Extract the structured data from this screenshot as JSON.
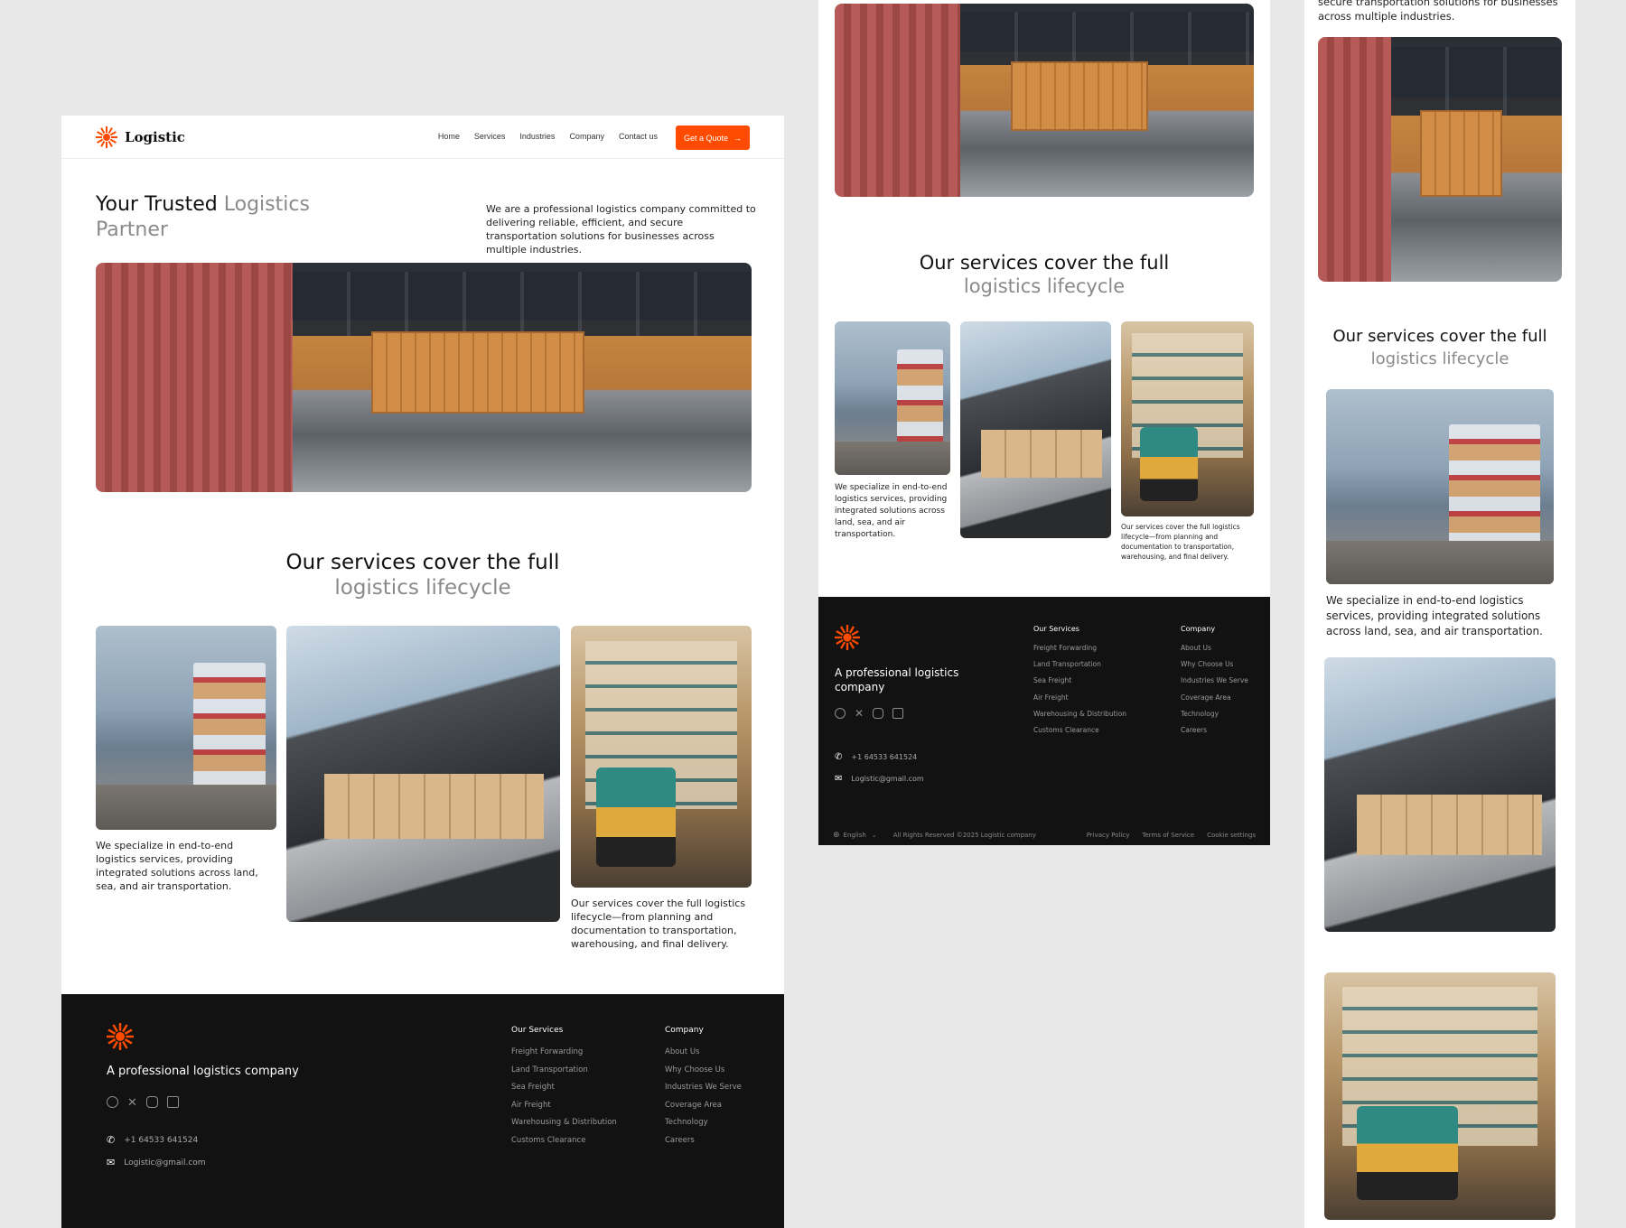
{
  "brand": {
    "name": "Logistic",
    "accent": "#ff4b00"
  },
  "nav": {
    "links": [
      "Home",
      "Services",
      "Industries",
      "Company",
      "Contact us"
    ],
    "cta": "Get a Quote",
    "cta_icon": "arrow-right-icon"
  },
  "hero": {
    "title_dark": "Your Trusted",
    "title_muted_1": "Logistics",
    "title_muted_2": "Partner",
    "description": "We are a professional logistics company committed to delivering reliable, efficient, and secure transportation solutions for businesses across multiple industries.",
    "description_partial": "secure transportation solutions for businesses across multiple industries."
  },
  "services": {
    "title_dark": "Our services cover the full",
    "title_muted": "logistics lifecycle",
    "caption_1": "We specialize in end-to-end logistics services, providing integrated solutions across land, sea, and air transportation.",
    "caption_2": "Our services cover the full logistics lifecycle—from planning and documentation to transportation, warehousing, and final delivery."
  },
  "footer": {
    "tagline": "A professional logistics company",
    "social_icons": [
      "facebook-icon",
      "x-icon",
      "instagram-icon",
      "linkedin-icon"
    ],
    "phone": "+1 64533 641524",
    "email": "Logistic@gmail.com",
    "services_heading": "Our Services",
    "services": [
      "Freight Forwarding",
      "Land Transportation",
      "Sea Freight",
      "Air Freight",
      "Warehousing & Distribution",
      "Customs Clearance"
    ],
    "company_heading": "Company",
    "company": [
      "About Us",
      "Why Choose Us",
      "Industries We Serve",
      "Coverage Area",
      "Technology",
      "Careers"
    ],
    "language": "English",
    "copyright": "All Rights Reserved ©2025 Logistic company",
    "legal": [
      "Privacy Policy",
      "Terms of Service",
      "Cookie settings"
    ]
  }
}
